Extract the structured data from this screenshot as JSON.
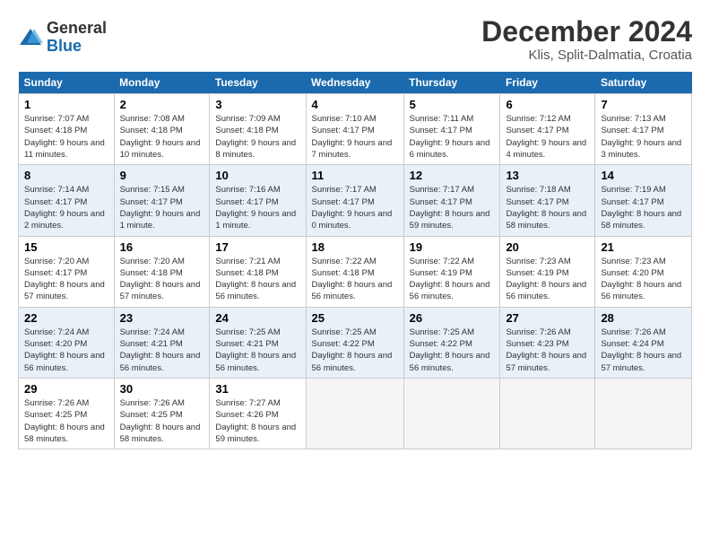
{
  "logo": {
    "general": "General",
    "blue": "Blue"
  },
  "title": {
    "month": "December 2024",
    "location": "Klis, Split-Dalmatia, Croatia"
  },
  "headers": [
    "Sunday",
    "Monday",
    "Tuesday",
    "Wednesday",
    "Thursday",
    "Friday",
    "Saturday"
  ],
  "weeks": [
    [
      {
        "day": "1",
        "sunrise": "7:07 AM",
        "sunset": "4:18 PM",
        "daylight": "9 hours and 11 minutes."
      },
      {
        "day": "2",
        "sunrise": "7:08 AM",
        "sunset": "4:18 PM",
        "daylight": "9 hours and 10 minutes."
      },
      {
        "day": "3",
        "sunrise": "7:09 AM",
        "sunset": "4:18 PM",
        "daylight": "9 hours and 8 minutes."
      },
      {
        "day": "4",
        "sunrise": "7:10 AM",
        "sunset": "4:17 PM",
        "daylight": "9 hours and 7 minutes."
      },
      {
        "day": "5",
        "sunrise": "7:11 AM",
        "sunset": "4:17 PM",
        "daylight": "9 hours and 6 minutes."
      },
      {
        "day": "6",
        "sunrise": "7:12 AM",
        "sunset": "4:17 PM",
        "daylight": "9 hours and 4 minutes."
      },
      {
        "day": "7",
        "sunrise": "7:13 AM",
        "sunset": "4:17 PM",
        "daylight": "9 hours and 3 minutes."
      }
    ],
    [
      {
        "day": "8",
        "sunrise": "7:14 AM",
        "sunset": "4:17 PM",
        "daylight": "9 hours and 2 minutes."
      },
      {
        "day": "9",
        "sunrise": "7:15 AM",
        "sunset": "4:17 PM",
        "daylight": "9 hours and 1 minute."
      },
      {
        "day": "10",
        "sunrise": "7:16 AM",
        "sunset": "4:17 PM",
        "daylight": "9 hours and 1 minute."
      },
      {
        "day": "11",
        "sunrise": "7:17 AM",
        "sunset": "4:17 PM",
        "daylight": "9 hours and 0 minutes."
      },
      {
        "day": "12",
        "sunrise": "7:17 AM",
        "sunset": "4:17 PM",
        "daylight": "8 hours and 59 minutes."
      },
      {
        "day": "13",
        "sunrise": "7:18 AM",
        "sunset": "4:17 PM",
        "daylight": "8 hours and 58 minutes."
      },
      {
        "day": "14",
        "sunrise": "7:19 AM",
        "sunset": "4:17 PM",
        "daylight": "8 hours and 58 minutes."
      }
    ],
    [
      {
        "day": "15",
        "sunrise": "7:20 AM",
        "sunset": "4:17 PM",
        "daylight": "8 hours and 57 minutes."
      },
      {
        "day": "16",
        "sunrise": "7:20 AM",
        "sunset": "4:18 PM",
        "daylight": "8 hours and 57 minutes."
      },
      {
        "day": "17",
        "sunrise": "7:21 AM",
        "sunset": "4:18 PM",
        "daylight": "8 hours and 56 minutes."
      },
      {
        "day": "18",
        "sunrise": "7:22 AM",
        "sunset": "4:18 PM",
        "daylight": "8 hours and 56 minutes."
      },
      {
        "day": "19",
        "sunrise": "7:22 AM",
        "sunset": "4:19 PM",
        "daylight": "8 hours and 56 minutes."
      },
      {
        "day": "20",
        "sunrise": "7:23 AM",
        "sunset": "4:19 PM",
        "daylight": "8 hours and 56 minutes."
      },
      {
        "day": "21",
        "sunrise": "7:23 AM",
        "sunset": "4:20 PM",
        "daylight": "8 hours and 56 minutes."
      }
    ],
    [
      {
        "day": "22",
        "sunrise": "7:24 AM",
        "sunset": "4:20 PM",
        "daylight": "8 hours and 56 minutes."
      },
      {
        "day": "23",
        "sunrise": "7:24 AM",
        "sunset": "4:21 PM",
        "daylight": "8 hours and 56 minutes."
      },
      {
        "day": "24",
        "sunrise": "7:25 AM",
        "sunset": "4:21 PM",
        "daylight": "8 hours and 56 minutes."
      },
      {
        "day": "25",
        "sunrise": "7:25 AM",
        "sunset": "4:22 PM",
        "daylight": "8 hours and 56 minutes."
      },
      {
        "day": "26",
        "sunrise": "7:25 AM",
        "sunset": "4:22 PM",
        "daylight": "8 hours and 56 minutes."
      },
      {
        "day": "27",
        "sunrise": "7:26 AM",
        "sunset": "4:23 PM",
        "daylight": "8 hours and 57 minutes."
      },
      {
        "day": "28",
        "sunrise": "7:26 AM",
        "sunset": "4:24 PM",
        "daylight": "8 hours and 57 minutes."
      }
    ],
    [
      {
        "day": "29",
        "sunrise": "7:26 AM",
        "sunset": "4:25 PM",
        "daylight": "8 hours and 58 minutes."
      },
      {
        "day": "30",
        "sunrise": "7:26 AM",
        "sunset": "4:25 PM",
        "daylight": "8 hours and 58 minutes."
      },
      {
        "day": "31",
        "sunrise": "7:27 AM",
        "sunset": "4:26 PM",
        "daylight": "8 hours and 59 minutes."
      },
      null,
      null,
      null,
      null
    ]
  ],
  "labels": {
    "sunrise": "Sunrise:",
    "sunset": "Sunset:",
    "daylight": "Daylight:"
  }
}
